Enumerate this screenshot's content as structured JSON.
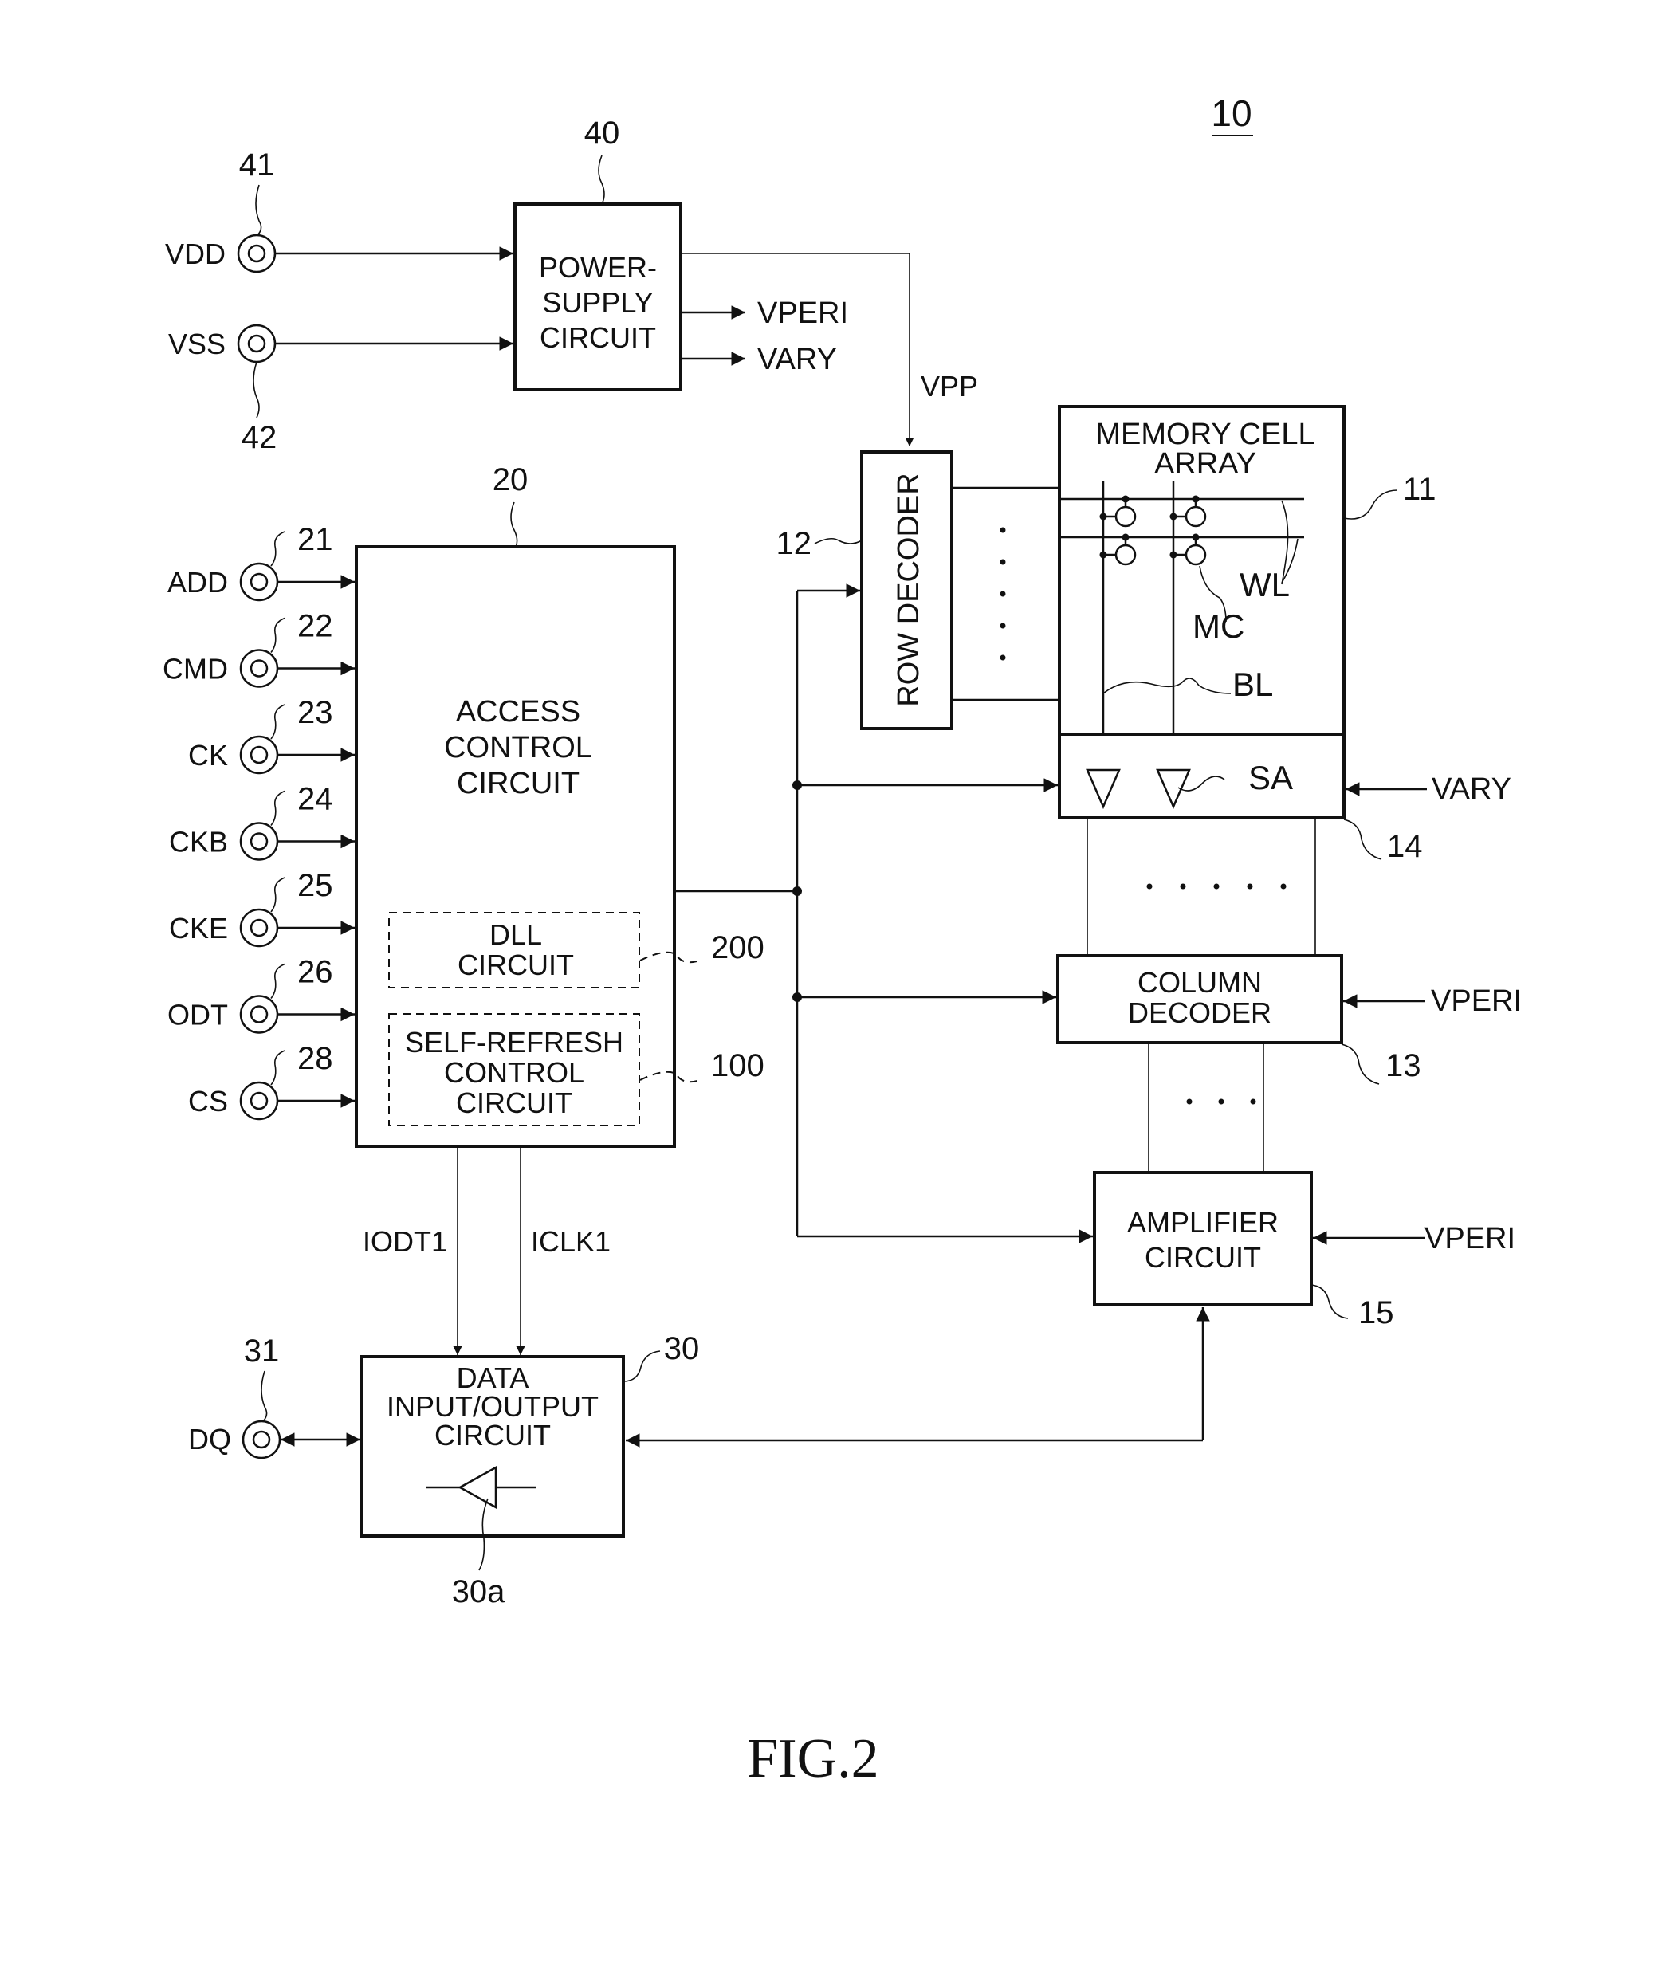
{
  "figure": {
    "ref_number": "10",
    "caption": "FIG.2"
  },
  "power_supply": {
    "ref": "40",
    "lines": [
      "POWER-",
      "SUPPLY",
      "CIRCUIT"
    ],
    "outputs": [
      "VPERI",
      "VARY"
    ],
    "vpp_label": "VPP"
  },
  "power_terminals": [
    {
      "label": "VDD",
      "ref": "41"
    },
    {
      "label": "VSS",
      "ref": "42"
    }
  ],
  "access_control": {
    "ref": "20",
    "lines": [
      "ACCESS",
      "CONTROL",
      "CIRCUIT"
    ],
    "dll": {
      "ref": "200",
      "lines": [
        "DLL",
        "CIRCUIT"
      ]
    },
    "self_refresh": {
      "ref": "100",
      "lines": [
        "SELF-REFRESH",
        "CONTROL",
        "CIRCUIT"
      ]
    }
  },
  "input_terminals": [
    {
      "label": "ADD",
      "ref": "21"
    },
    {
      "label": "CMD",
      "ref": "22"
    },
    {
      "label": "CK",
      "ref": "23"
    },
    {
      "label": "CKB",
      "ref": "24"
    },
    {
      "label": "CKE",
      "ref": "25"
    },
    {
      "label": "ODT",
      "ref": "26"
    },
    {
      "label": "CS",
      "ref": "28"
    }
  ],
  "row_decoder": {
    "ref": "12",
    "label": "ROW DECODER"
  },
  "memory_array": {
    "ref": "11",
    "lines": [
      "MEMORY CELL",
      "ARRAY"
    ],
    "wl": "WL",
    "mc": "MC",
    "bl": "BL"
  },
  "sense_amp": {
    "ref": "14",
    "label": "SA",
    "supply": "VARY"
  },
  "column_decoder": {
    "ref": "13",
    "lines": [
      "COLUMN",
      "DECODER"
    ],
    "supply": "VPERI"
  },
  "amplifier": {
    "ref": "15",
    "lines": [
      "AMPLIFIER",
      "CIRCUIT"
    ],
    "supply": "VPERI"
  },
  "data_io": {
    "ref": "30",
    "lines": [
      "DATA",
      "INPUT/OUTPUT",
      "CIRCUIT"
    ],
    "buffer_ref": "30a",
    "signals": [
      "IODT1",
      "ICLK1"
    ],
    "terminal": {
      "label": "DQ",
      "ref": "31"
    }
  }
}
